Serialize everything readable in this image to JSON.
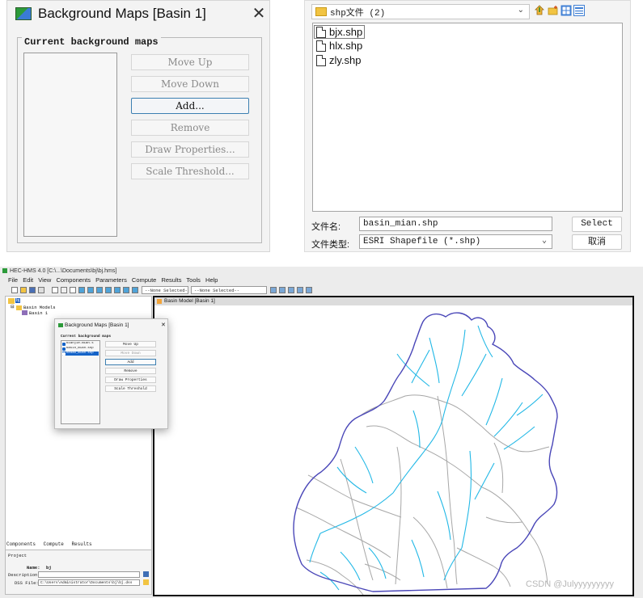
{
  "dialog1": {
    "title": "Background Maps [Basin 1]",
    "close": "✕",
    "group_label": "Current background maps",
    "buttons": [
      "Move Up",
      "Move Down",
      "Add...",
      "Remove",
      "Draw Properties...",
      "Scale Threshold..."
    ]
  },
  "file_dialog": {
    "path": "shp文件 (2)",
    "files": [
      "bjx.shp",
      "hlx.shp",
      "zly.shp"
    ],
    "filename_label": "文件名:",
    "filename_value": "basin_mian.shp",
    "filetype_label": "文件类型:",
    "filetype_value": "ESRI Shapefile (*.shp)",
    "select_label": "Select",
    "cancel_label": "取消"
  },
  "hms": {
    "title": "HEC-HMS 4.0 [C:\\...\\Documents\\bj\\bj.hms]",
    "menu": [
      "File",
      "Edit",
      "View",
      "Components",
      "Parameters",
      "Compute",
      "Results",
      "Tools",
      "Help"
    ],
    "toolbar_select1": "--None Selected--",
    "toolbar_select2": "--None Selected--",
    "tree": {
      "root": "bj",
      "folder": "Basin Models",
      "item": "Basin 1"
    },
    "tabs": [
      "Components",
      "Compute",
      "Results"
    ],
    "props": {
      "tab": "Project",
      "name_label": "Name:",
      "name_value": "bj",
      "desc_label": "Description:",
      "dss_label": "DSS File:",
      "dss_value": "C:\\Users\\Administrator\\Documents\\bj\\bj.dss"
    },
    "map_title": "Basin Model [Basin 1]",
    "mini_dialog": {
      "title": "Background Maps [Basin 1]",
      "close": "✕",
      "group_label": "Current background maps",
      "list": [
        "bianjie-mian.s",
        "basin_mian.shp",
        "hedao_mian.shp"
      ],
      "buttons": [
        "Move Up",
        "Move Down",
        "Add",
        "Remove",
        "Draw Properties",
        "Scale Threshold"
      ]
    }
  },
  "watermark": "CSDN @Julyyyyyyyyy",
  "colors": {
    "boundary": "#4a47b8",
    "rivers": "#22b8e6",
    "subbasins": "#a7a7a7",
    "selection": "#1463c8"
  }
}
